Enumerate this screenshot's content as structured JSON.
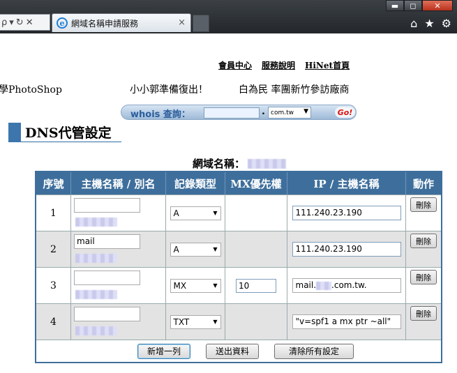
{
  "browser": {
    "tab_title": "網域名稱申請服務",
    "tab_close": "×",
    "addr_icons": [
      "ρ",
      "▾",
      "↻",
      "✕"
    ],
    "window_buttons": {
      "minimize": "▬",
      "maximize": "◻",
      "close": "✕"
    },
    "nav_icons": {
      "home": "⌂",
      "favorites": "★",
      "tools": "⚙"
    }
  },
  "header": {
    "links": [
      "會員中心",
      "服務說明",
      "HiNet首頁"
    ]
  },
  "marquee": {
    "items": [
      "學PhotoShop",
      "小小郭準備復出！",
      "白為民 率團新竹參訪廠商"
    ]
  },
  "whois": {
    "label": "whois 查詢：",
    "input_value": "",
    "dot": ".",
    "tld_selected": "com.tw",
    "go_label": "Go!"
  },
  "section": {
    "title": "DNS代管設定"
  },
  "domain": {
    "label": "網域名稱："
  },
  "table": {
    "headers": [
      "序號",
      "主機名稱 / 別名",
      "記錄類型",
      "MX優先權",
      "IP / 主機名稱",
      "動作"
    ],
    "rows": [
      {
        "index": "1",
        "host": "",
        "type": "A",
        "mx": "",
        "ip": "111.240.23.190",
        "action": "刪除"
      },
      {
        "index": "2",
        "host": "mail",
        "type": "A",
        "mx": "",
        "ip": "111.240.23.190",
        "action": "刪除"
      },
      {
        "index": "3",
        "host": "",
        "type": "MX",
        "mx": "10",
        "ip_prefix": "mail.",
        "ip_suffix": ".com.tw.",
        "action": "刪除"
      },
      {
        "index": "4",
        "host": "",
        "type": "TXT",
        "mx": "",
        "ip": "\"v=spf1 a mx ptr ~all\"",
        "action": "刪除"
      }
    ],
    "buttons": {
      "add_row": "新增一列",
      "submit": "送出資料",
      "clear": "清除所有設定"
    }
  },
  "colors": {
    "table_header": "#3e6f9c",
    "row_alt": "#e3e3e3",
    "go_red": "#dd1111"
  }
}
